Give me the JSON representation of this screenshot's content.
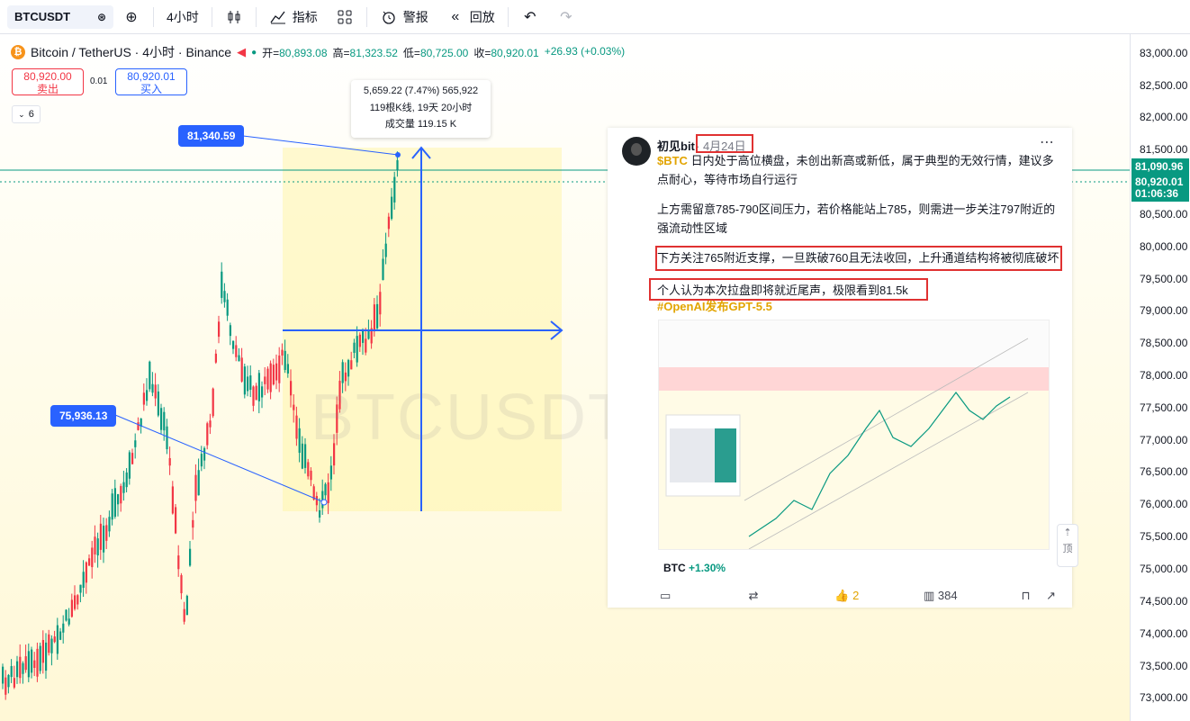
{
  "toolbar": {
    "symbol": "BTCUSDT",
    "interval": "4小时",
    "indicators_label": "指标",
    "alert_label": "警报",
    "replay_label": "回放"
  },
  "legend": {
    "title": "Bitcoin / TetherUS · 4小时 · Binance",
    "open_label": "开=",
    "open": "80,893.08",
    "high_label": "高=",
    "high": "81,323.52",
    "low_label": "低=",
    "low": "80,725.00",
    "close_label": "收=",
    "close": "80,920.01",
    "change": "+26.93 (+0.03%)"
  },
  "trade": {
    "sell_price": "80,920.00",
    "sell_label": "卖出",
    "spread": "0.01",
    "buy_price": "80,920.01",
    "buy_label": "买入",
    "indicators_count": "6"
  },
  "measure": {
    "line1": "5,659.22 (7.47%) 565,922",
    "line2": "119根K线, 19天 20小时",
    "line3": "成交量 119.15 K"
  },
  "callouts": {
    "high": "81,340.59",
    "low": "75,936.13"
  },
  "watermark": "BTCUSDT",
  "price_axis": {
    "ticks": [
      "83,000.00",
      "82,500.00",
      "82,000.00",
      "81,500.00",
      "80,500.00",
      "80,000.00",
      "79,500.00",
      "79,000.00",
      "78,500.00",
      "78,000.00",
      "77,500.00",
      "77,000.00",
      "76,500.00",
      "76,000.00",
      "75,500.00",
      "75,000.00",
      "74,500.00",
      "74,000.00",
      "73,500.00",
      "73,000.00"
    ],
    "level_label": "81,090.96",
    "last_price": "80,920.01",
    "countdown": "01:06:36"
  },
  "colors": {
    "up": "#089981",
    "down": "#f23645",
    "accent": "#2962ff",
    "highlight": "#e03131"
  },
  "post": {
    "author": "初见bit",
    "date": "· 4月24日",
    "tag": "$BTC",
    "p1": "日内处于高位横盘，未创出新高或新低，属于典型的无效行情，建议多点耐心，等待市场自行运行",
    "p2": "上方需留意785-790区间压力，若价格能站上785，则需进一步关注797附近的强流动性区域",
    "p3": "下方关注765附近支撑，一旦跌破760且无法收回，上升通道结构将被彻底破坏",
    "p4": "个人认为本次拉盘即将就近尾声，极限看到81.5k",
    "hashtag": "#OpenAI发布GPT-5.5",
    "coin": "BTC",
    "coin_change": "+1.30%",
    "likes": "2",
    "views": "384",
    "scroll_top": "顶"
  }
}
